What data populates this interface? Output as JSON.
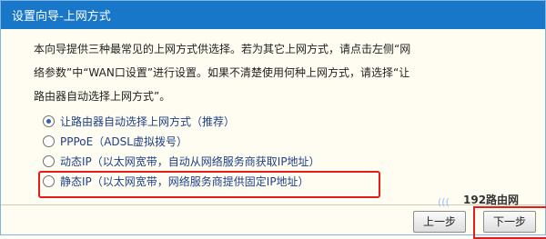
{
  "window": {
    "title": "设置向导-上网方式"
  },
  "description": [
    "本向导提供三种最常见的上网方式供选择。若为其它上网方式，请点击左侧“网",
    "络参数”中“WAN口设置”进行设置。如果不清楚使用何种上网方式，请选择“让",
    "路由器自动选择上网方式”。"
  ],
  "options": [
    {
      "label": "让路由器自动选择上网方式（推荐）",
      "selected": true
    },
    {
      "label": "PPPoE（ADSL虚拟拨号）",
      "selected": false
    },
    {
      "label": "动态IP（以太网宽带，自动从网络服务商获取IP地址）",
      "selected": false
    },
    {
      "label": "静态IP（以太网宽带，网络服务商提供固定IP地址）",
      "selected": false
    }
  ],
  "buttons": {
    "prev": "上一步",
    "next": "下一步"
  },
  "watermark": {
    "text": "192路由网"
  },
  "colors": {
    "titlebar": "#1877c9",
    "highlight": "#e41c1c",
    "panel": "#fffdf2"
  }
}
